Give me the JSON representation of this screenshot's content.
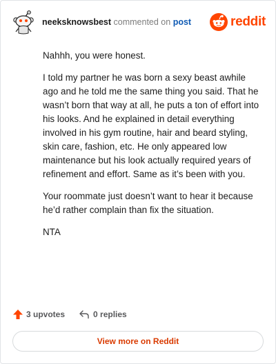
{
  "header": {
    "username": "neeksknowsbest",
    "action_text": " commented on ",
    "post_link": "post",
    "logo_text": "reddit",
    "avatar_icon": "snoo-avatar-icon",
    "logo_icon": "reddit-snoo-icon"
  },
  "comment": {
    "paragraphs": [
      "Nahhh, you were honest.",
      "I told my partner he was born a sexy beast awhile ago and he told me the same thing you said. That he wasn’t born that way at all, he puts a ton of effort into his looks. And he explained in detail everything involved in his gym routine, hair and beard styling, skin care, fashion, etc. He only appeared low maintenance but his look actually required years of refinement and effort. Same as it’s been with you.",
      "Your roommate just doesn’t want to hear it because he’d rather complain than fix the situation.",
      "NTA"
    ]
  },
  "actions": {
    "upvotes": "3 upvotes",
    "replies": "0 replies",
    "upvote_icon": "upvote-arrow-icon",
    "reply_icon": "reply-arrow-icon"
  },
  "footer": {
    "view_more": "View more on Reddit"
  },
  "colors": {
    "accent": "#ff4500",
    "link": "#0f5ab4",
    "view_more_text": "#d93a00"
  }
}
